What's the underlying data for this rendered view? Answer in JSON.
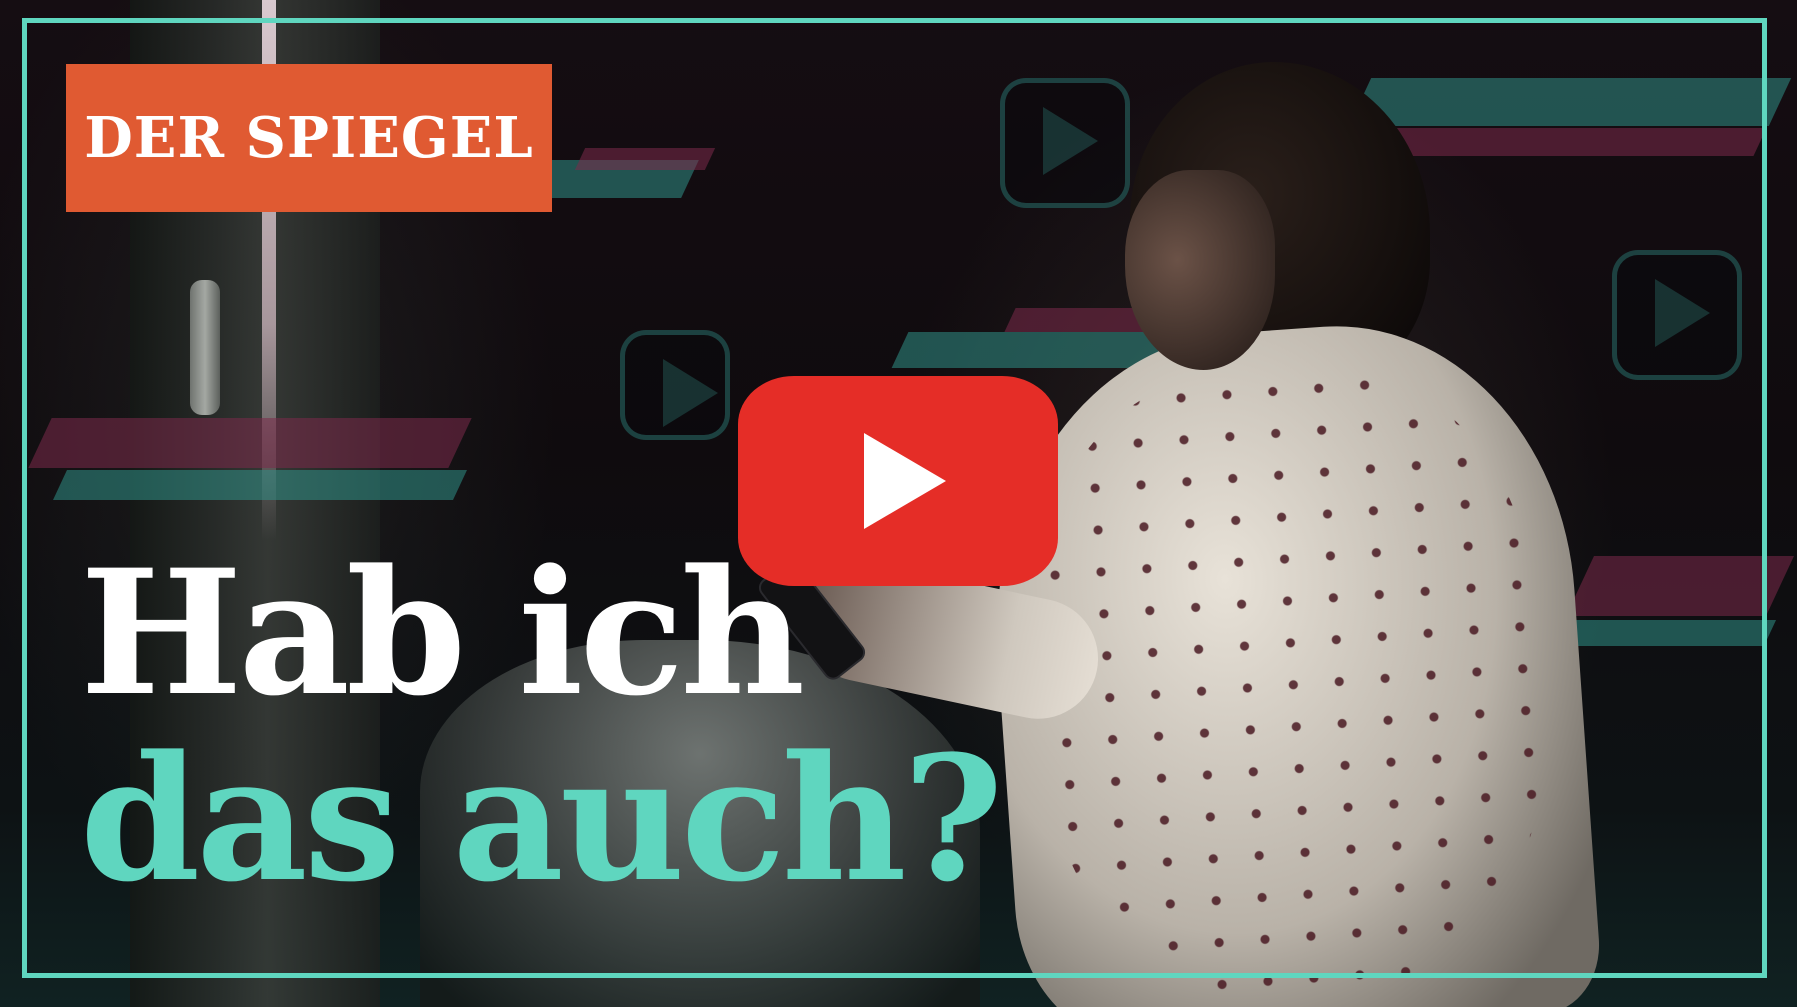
{
  "logo": {
    "text": "DER SPIEGEL"
  },
  "headline": {
    "line1": "Hab ich",
    "line2": "das auch?"
  },
  "colors": {
    "logo_bg": "#e05a32",
    "accent_teal": "#5fd6bf",
    "play_red": "#e52d27",
    "stripe_pink": "#7c2a4a"
  },
  "icons": {
    "play": "youtube-play-icon"
  }
}
